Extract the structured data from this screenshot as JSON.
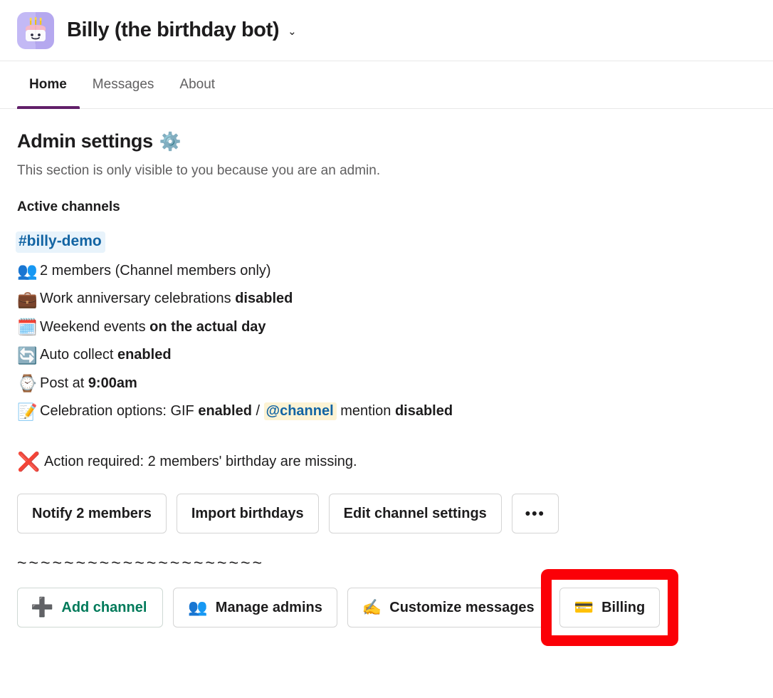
{
  "header": {
    "app_icon": "birthday-cake-icon",
    "title": "Billy (the birthday bot)",
    "chevron": "⌄"
  },
  "tabs": [
    {
      "label": "Home",
      "active": true
    },
    {
      "label": "Messages",
      "active": false
    },
    {
      "label": "About",
      "active": false
    }
  ],
  "main": {
    "page_title": "Admin settings",
    "page_title_emoji": "⚙️",
    "subtitle": "This section is only visible to you because you are an admin.",
    "section_title": "Active channels",
    "channel": "#billy-demo",
    "settings": [
      {
        "emoji": "👥",
        "emoji_name": "busts-in-silhouette-icon",
        "parts": [
          {
            "text": "2 members (Channel members only)",
            "bold": false
          }
        ]
      },
      {
        "emoji": "💼",
        "emoji_name": "briefcase-icon",
        "parts": [
          {
            "text": "Work anniversary celebrations ",
            "bold": false
          },
          {
            "text": "disabled",
            "bold": true
          }
        ]
      },
      {
        "emoji": "🗓️",
        "emoji_name": "spiral-calendar-icon",
        "parts": [
          {
            "text": "Weekend events ",
            "bold": false
          },
          {
            "text": "on the actual day",
            "bold": true
          }
        ]
      },
      {
        "emoji": "🔄",
        "emoji_name": "arrows-counterclockwise-icon",
        "parts": [
          {
            "text": "Auto collect ",
            "bold": false
          },
          {
            "text": "enabled",
            "bold": true
          }
        ]
      },
      {
        "emoji": "⌚",
        "emoji_name": "watch-icon",
        "parts": [
          {
            "text": "Post at ",
            "bold": false
          },
          {
            "text": "9:00am",
            "bold": true
          }
        ]
      },
      {
        "emoji": "📝",
        "emoji_name": "memo-icon",
        "parts": [
          {
            "text": "Celebration options: GIF ",
            "bold": false
          },
          {
            "text": "enabled",
            "bold": true
          },
          {
            "text": " / ",
            "bold": false
          },
          {
            "text": "@channel",
            "bold": true,
            "mention": true
          },
          {
            "text": " mention ",
            "bold": false
          },
          {
            "text": "disabled",
            "bold": true
          }
        ]
      }
    ],
    "action_required": {
      "emoji": "❌",
      "emoji_name": "cross-mark-icon",
      "text": "Action required: 2 members' birthday are missing."
    },
    "channel_actions": [
      {
        "label": "Notify 2 members",
        "name": "notify-members-button"
      },
      {
        "label": "Import birthdays",
        "name": "import-birthdays-button"
      },
      {
        "label": "Edit channel settings",
        "name": "edit-channel-settings-button"
      },
      {
        "label": "•••",
        "name": "more-options-button"
      }
    ],
    "divider": "~~~~~~~~~~~~~~~~~~~~~",
    "global_actions": [
      {
        "label": "Add channel",
        "emoji": "➕",
        "emoji_name": "plus-icon",
        "name": "add-channel-button"
      },
      {
        "label": "Manage admins",
        "emoji": "👥",
        "emoji_name": "busts-in-silhouette-icon",
        "name": "manage-admins-button"
      },
      {
        "label": "Customize messages",
        "emoji": "✍️",
        "emoji_name": "writing-hand-icon",
        "name": "customize-messages-button"
      },
      {
        "label": "Billing",
        "emoji": "💳",
        "emoji_name": "credit-card-icon",
        "name": "billing-button"
      }
    ]
  },
  "colors": {
    "accent_purple": "#611f69",
    "link_blue": "#1264a3",
    "green": "#007a5a",
    "annotation_red": "#fb0007",
    "mention_bg": "#fdf3d4"
  }
}
